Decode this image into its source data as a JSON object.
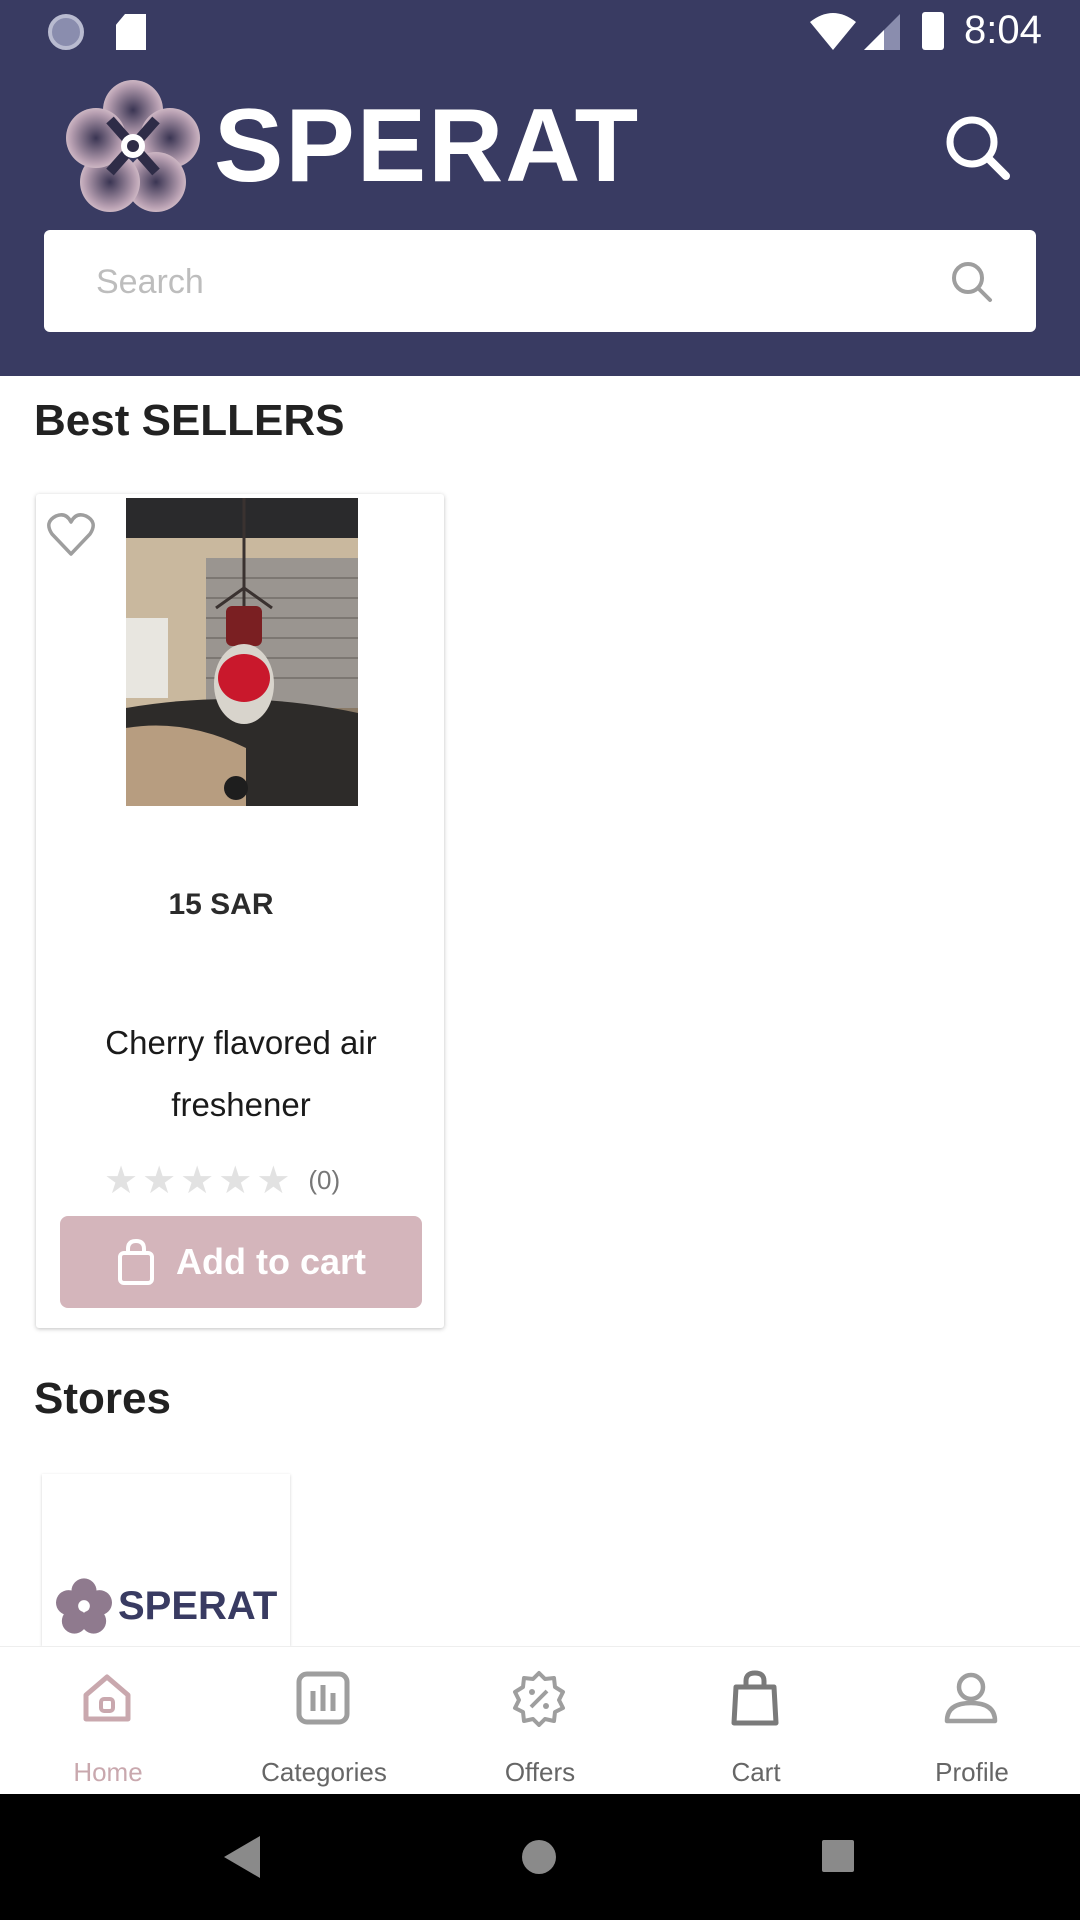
{
  "status_bar": {
    "time": "8:04"
  },
  "header": {
    "brand": "SPERAT"
  },
  "search": {
    "placeholder": "Search"
  },
  "best_sellers": {
    "title": "Best SELLERS",
    "products": [
      {
        "price": "15 SAR",
        "name": "Cherry flavored air freshener",
        "rating_count": "(0)",
        "stars_filled": 0,
        "stars_total": 5,
        "add_to_cart_label": "Add to cart"
      }
    ]
  },
  "stores": {
    "title": "Stores",
    "items": [
      {
        "logo_text": "SPERAT"
      }
    ]
  },
  "bottom_nav": {
    "items": [
      {
        "label": "Home",
        "icon": "home-icon",
        "active": true
      },
      {
        "label": "Categories",
        "icon": "categories-icon",
        "active": false
      },
      {
        "label": "Offers",
        "icon": "offers-icon",
        "active": false
      },
      {
        "label": "Cart",
        "icon": "cart-icon",
        "active": false
      },
      {
        "label": "Profile",
        "icon": "profile-icon",
        "active": false
      }
    ]
  },
  "colors": {
    "header_bg": "#393b62",
    "accent_pink": "#d4b5bb",
    "active_nav": "#c9a8ae"
  }
}
